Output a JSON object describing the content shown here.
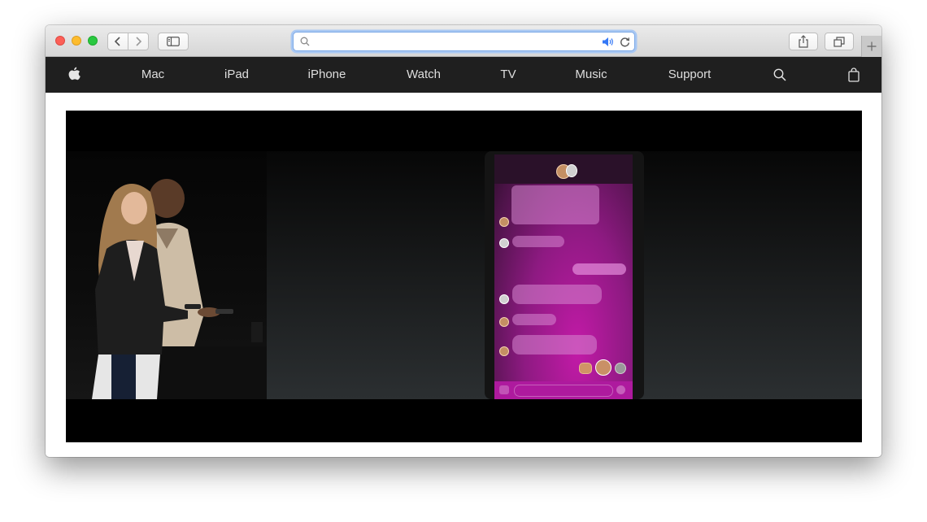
{
  "browser": {
    "window_controls": [
      "close",
      "minimize",
      "zoom"
    ],
    "nav_buttons": {
      "back_icon": "chevron-left-icon",
      "forward_icon": "chevron-right-icon"
    },
    "sidebar_icon": "sidebar-icon",
    "address_bar": {
      "value": "",
      "placeholder": "",
      "search_icon": "search-icon",
      "audio_icon": "speaker-icon",
      "reload_icon": "reload-icon"
    },
    "share_icon": "share-icon",
    "tabs_icon": "tabs-overview-icon",
    "new_tab_icon": "plus-icon"
  },
  "site_nav": {
    "logo_icon": "apple-logo-icon",
    "items": [
      {
        "label": "Mac"
      },
      {
        "label": "iPad"
      },
      {
        "label": "iPhone"
      },
      {
        "label": "Watch"
      },
      {
        "label": "TV"
      },
      {
        "label": "Music"
      },
      {
        "label": "Support"
      }
    ],
    "search_icon": "search-icon",
    "bag_icon": "shopping-bag-icon",
    "background": "#1f1f1f",
    "text_color": "#dedede"
  },
  "video": {
    "content": "keynote-presentation",
    "left_panel": "presenters-on-stage",
    "right_panel": "iphone-messages-screen",
    "accent_color": "#c21aa7"
  }
}
